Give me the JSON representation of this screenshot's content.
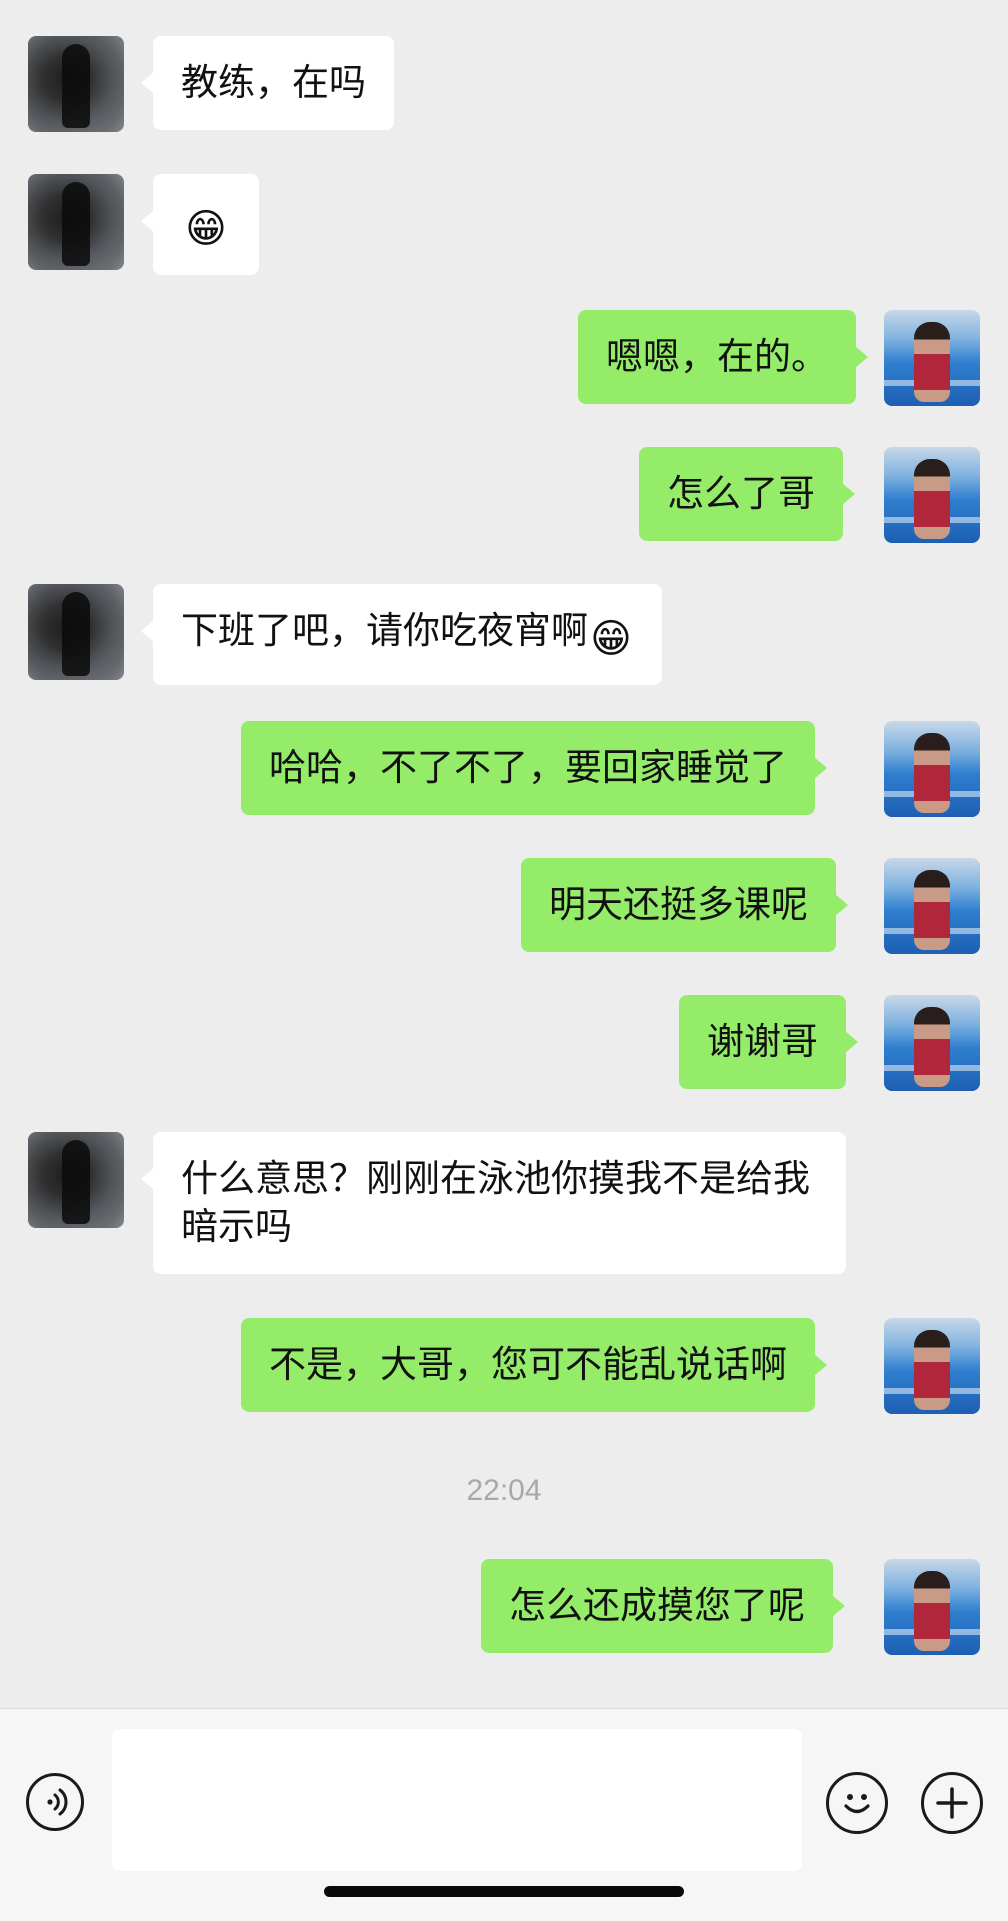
{
  "messages": {
    "m1": "教练，在吗",
    "m2_emoji": "😁",
    "m3": "嗯嗯，在的。",
    "m4": "怎么了哥",
    "m5": "下班了吧，请你吃夜宵啊",
    "m5_emoji": "😁",
    "m6": "哈哈，不了不了，要回家睡觉了",
    "m7": "明天还挺多课呢",
    "m8": "谢谢哥",
    "m9": "什么意思？刚刚在泳池你摸我不是给我暗示吗",
    "m10": "不是，大哥，您可不能乱说话啊",
    "m11": "怎么还成摸您了呢"
  },
  "timestamp": "22:04",
  "input": {
    "value": "",
    "placeholder": ""
  },
  "icons": {
    "voice": "voice-icon",
    "emoji": "emoji-icon",
    "plus": "plus-icon"
  },
  "colors": {
    "background": "#ededed",
    "sent_bubble": "#95ec69",
    "received_bubble": "#ffffff",
    "timestamp": "#a8a8a8"
  }
}
